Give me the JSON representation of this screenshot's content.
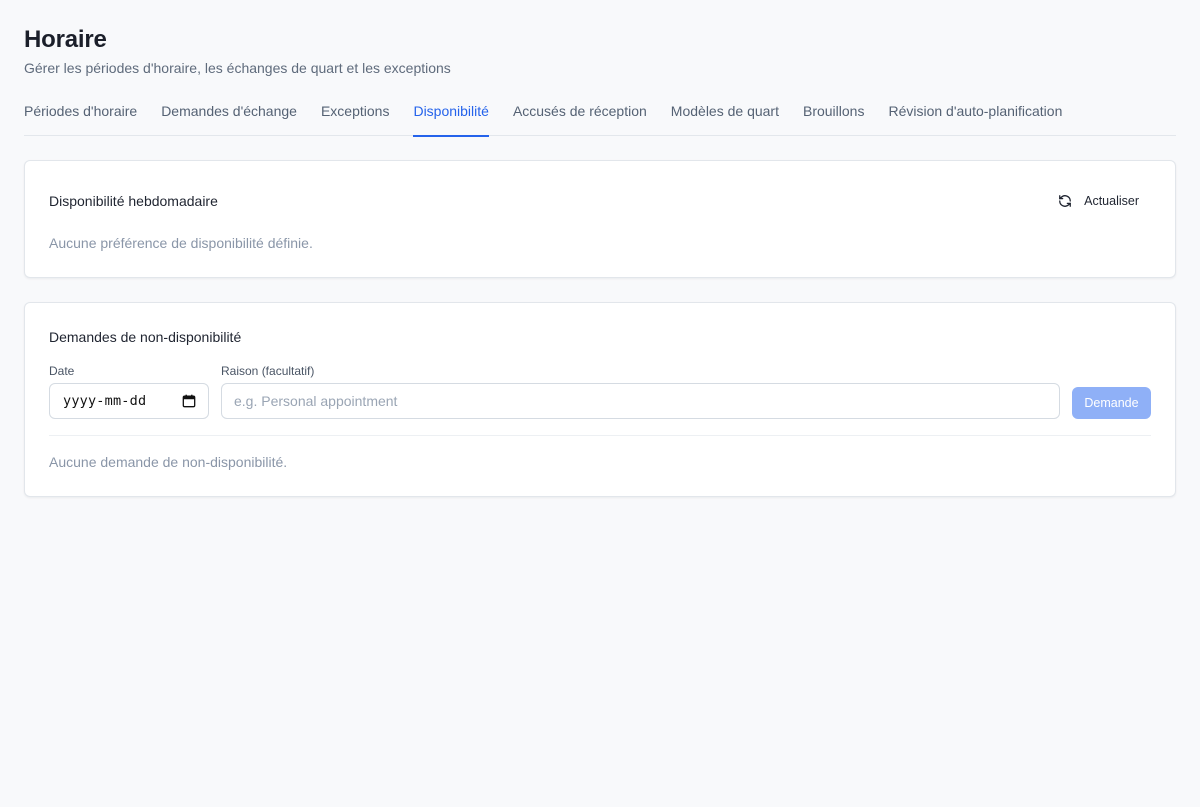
{
  "header": {
    "title": "Horaire",
    "subtitle": "Gérer les périodes d'horaire, les échanges de quart et les exceptions"
  },
  "tabs": [
    {
      "label": "Périodes d'horaire",
      "active": false
    },
    {
      "label": "Demandes d'échange",
      "active": false
    },
    {
      "label": "Exceptions",
      "active": false
    },
    {
      "label": "Disponibilité",
      "active": true
    },
    {
      "label": "Accusés de réception",
      "active": false
    },
    {
      "label": "Modèles de quart",
      "active": false
    },
    {
      "label": "Brouillons",
      "active": false
    },
    {
      "label": "Révision d'auto-planification",
      "active": false
    }
  ],
  "weekly_availability": {
    "title": "Disponibilité hebdomadaire",
    "refresh_label": "Actualiser",
    "refresh_icon": "refresh-icon",
    "empty_text": "Aucune préférence de disponibilité définie."
  },
  "unavailability": {
    "title": "Demandes de non-disponibilité",
    "date_label": "Date",
    "date_value": "yyyy-mm-dd",
    "date_icon": "calendar-icon",
    "reason_label": "Raison (facultatif)",
    "reason_placeholder": "e.g. Personal appointment",
    "reason_value": "",
    "submit_label": "Demande",
    "submit_enabled": false,
    "empty_text": "Aucune demande de non-disponibilité."
  },
  "colors": {
    "accent": "#2563eb",
    "submit_disabled": "#8fb0f7",
    "background": "#f8f9fb"
  }
}
